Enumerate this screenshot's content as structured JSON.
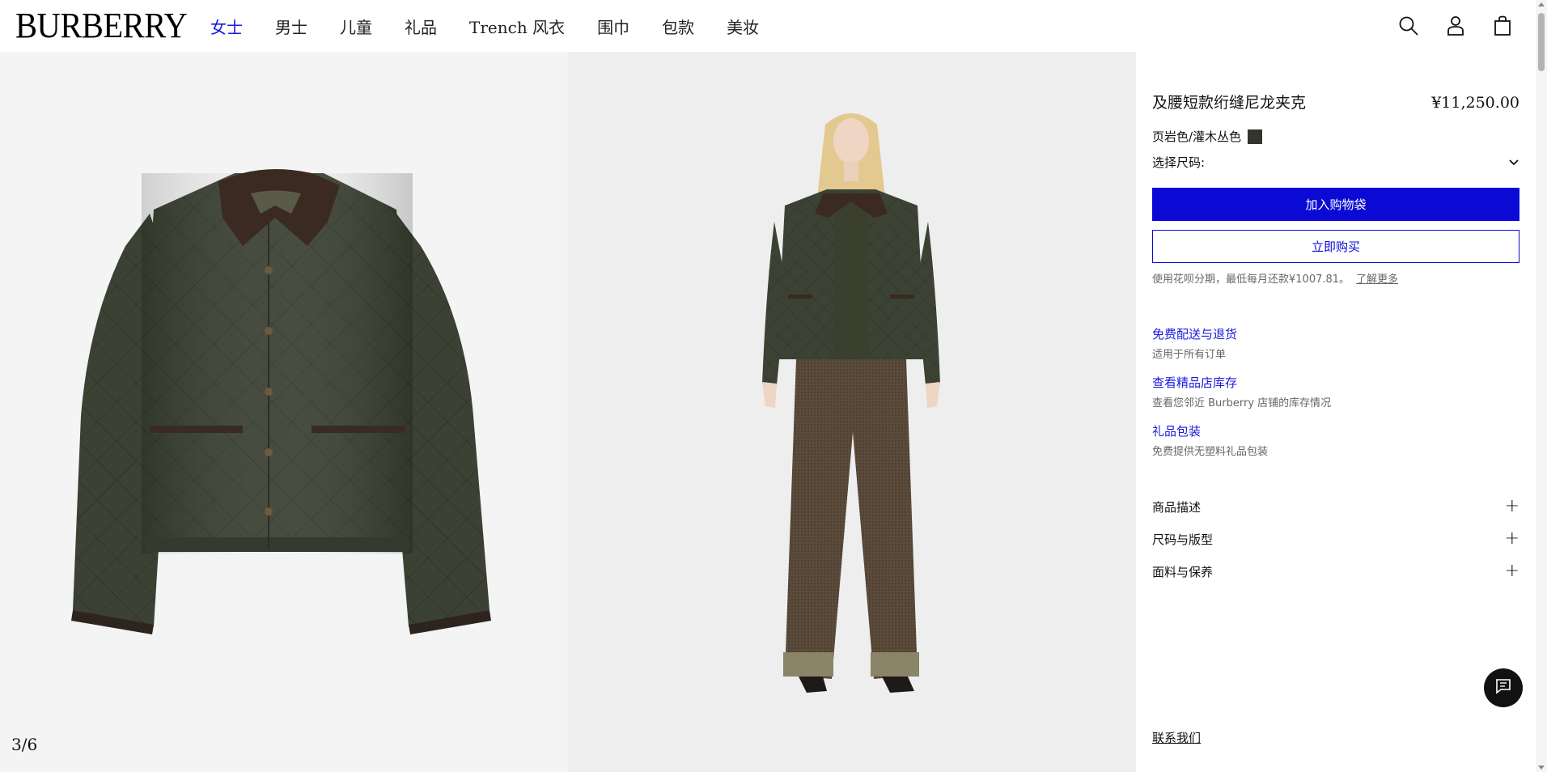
{
  "header": {
    "logo": "BURBERRY",
    "nav": [
      "女士",
      "男士",
      "儿童",
      "礼品",
      "Trench 风衣",
      "围巾",
      "包款",
      "美妆"
    ],
    "active_nav": "女士",
    "icons": [
      "search-icon",
      "account-icon",
      "bag-icon"
    ]
  },
  "gallery": {
    "counter": "3/6"
  },
  "product": {
    "title": "及腰短款绗缝尼龙夹克",
    "price": "¥11,250.00",
    "color_label": "页岩色/灌木丛色",
    "color_swatch": "#31352a",
    "size_label": "选择尺码:",
    "add_to_bag": "加入购物袋",
    "buy_now": "立即购买",
    "installment_text": "使用花呗分期，最低每月还款¥1007.81。",
    "learn_more": "了解更多"
  },
  "services": [
    {
      "title": "免费配送与退货",
      "subtitle": "适用于所有订单"
    },
    {
      "title": "查看精品店库存",
      "subtitle": "查看您邻近 Burberry 店铺的库存情况"
    },
    {
      "title": "礼品包装",
      "subtitle": "免费提供无塑料礼品包装"
    }
  ],
  "accordion": [
    "商品描述",
    "尺码与版型",
    "面料与保养"
  ],
  "contact": "联系我们",
  "colors": {
    "accent": "#0a0ad4",
    "jacket": "#3a3f32",
    "collar": "#3a2a22",
    "trousers": "#5a4a3a"
  }
}
